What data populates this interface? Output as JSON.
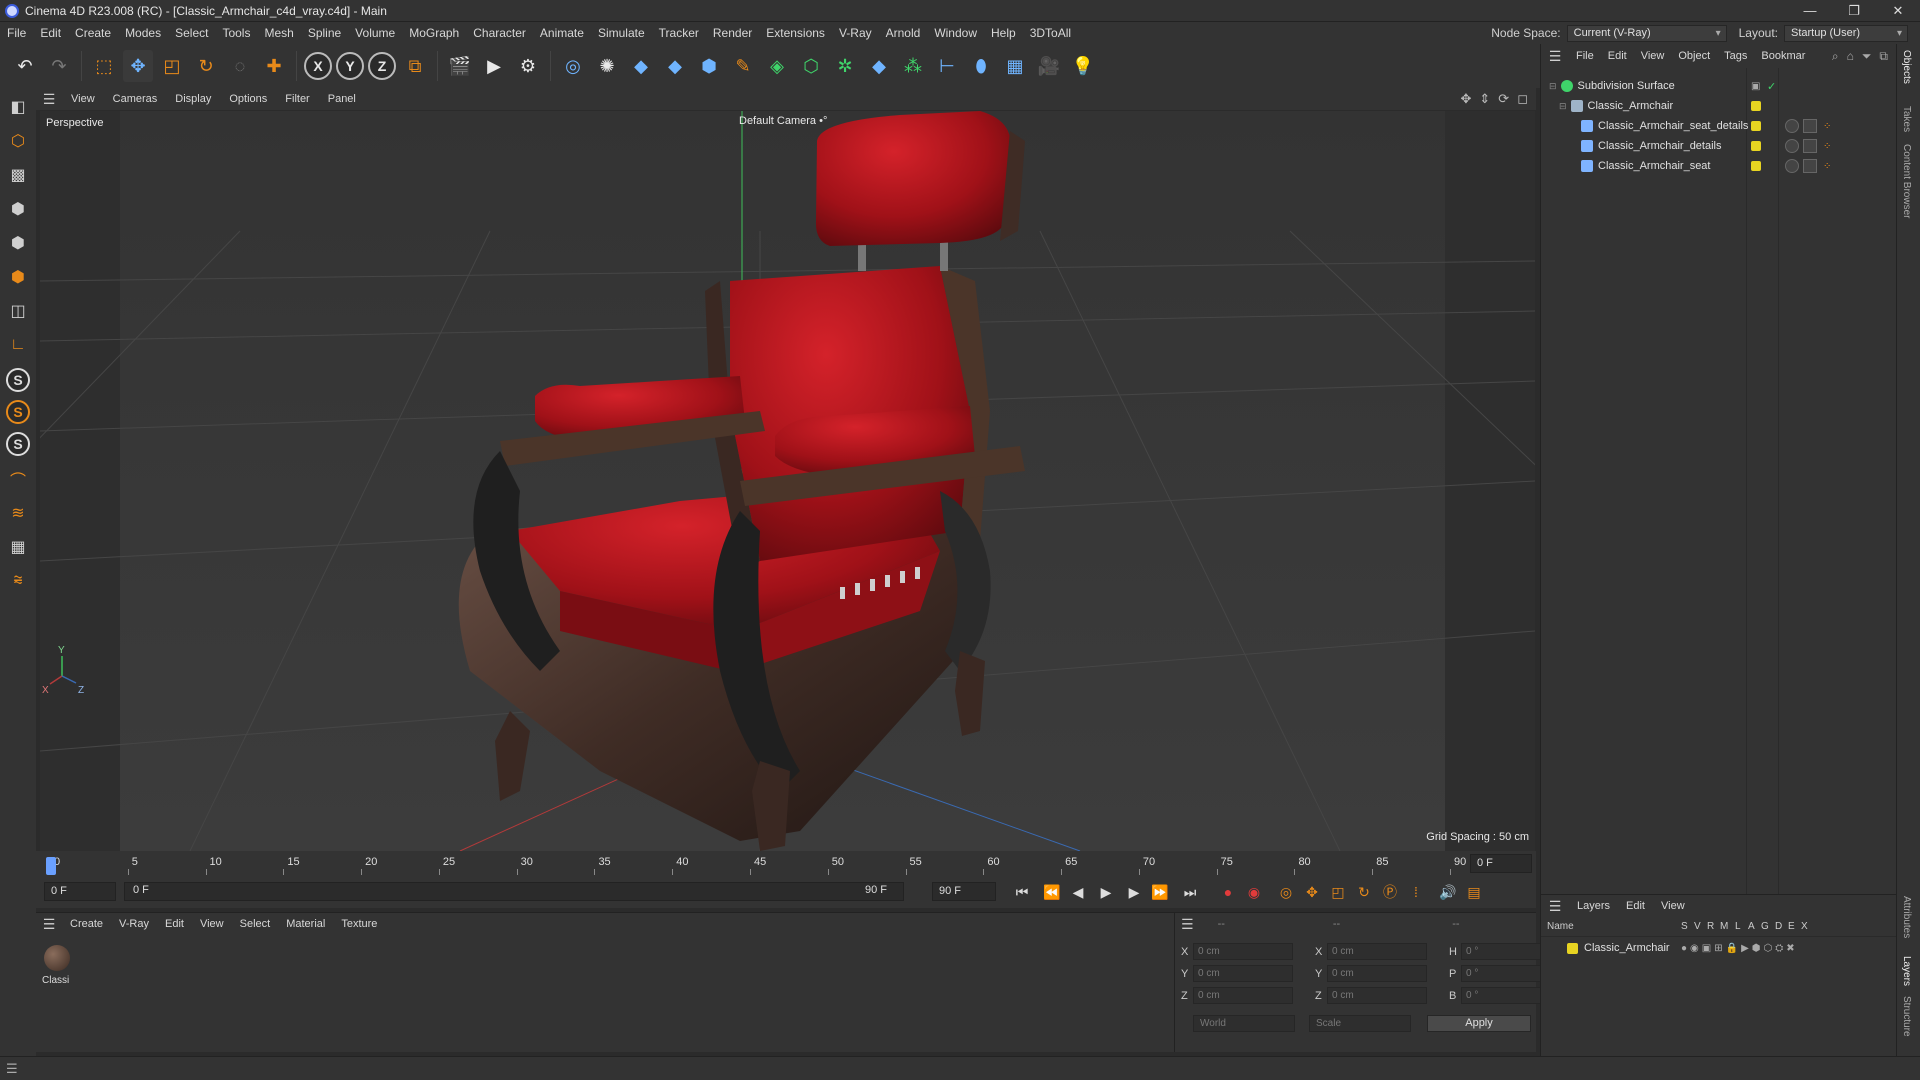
{
  "window": {
    "title": "Cinema 4D R23.008 (RC) - [Classic_Armchair_c4d_vray.c4d] - Main",
    "controls": [
      "—",
      "❐",
      "✕"
    ]
  },
  "menubar": {
    "items": [
      "File",
      "Edit",
      "Create",
      "Modes",
      "Select",
      "Tools",
      "Mesh",
      "Spline",
      "Volume",
      "MoGraph",
      "Character",
      "Animate",
      "Simulate",
      "Tracker",
      "Render",
      "Extensions",
      "V-Ray",
      "Arnold",
      "Window",
      "Help",
      "3DToAll"
    ],
    "node_space_label": "Node Space:",
    "node_space_value": "Current (V-Ray)",
    "layout_label": "Layout:",
    "layout_value": "Startup (User)"
  },
  "toolbar": {
    "axis_x": "X",
    "axis_y": "Y",
    "axis_z": "Z"
  },
  "left_toolbar": {
    "snap_s": "S"
  },
  "viewport": {
    "menu": [
      "View",
      "Cameras",
      "Display",
      "Options",
      "Filter",
      "Panel"
    ],
    "label": "Perspective",
    "camera": "Default Camera",
    "camera_suffix": "•°",
    "grid_spacing": "Grid Spacing : 50 cm",
    "axis_labels": {
      "x": "X",
      "y": "Y",
      "z": "Z"
    }
  },
  "timeline": {
    "ticks": [
      "0",
      "5",
      "10",
      "15",
      "20",
      "25",
      "30",
      "35",
      "40",
      "45",
      "50",
      "55",
      "60",
      "65",
      "70",
      "75",
      "80",
      "85",
      "90"
    ],
    "current": "0 F"
  },
  "transport": {
    "start": "0 F",
    "range_start": "0 F",
    "range_end": "90 F",
    "end": "90 F"
  },
  "material_manager": {
    "menu": [
      "Create",
      "V-Ray",
      "Edit",
      "View",
      "Select",
      "Material",
      "Texture"
    ],
    "materials": [
      {
        "name": "Classi"
      }
    ]
  },
  "coordinates": {
    "header_1": "--",
    "header_2": "--",
    "header_3": "--",
    "rows": [
      {
        "a1": "X",
        "v1": "0 cm",
        "a2": "X",
        "v2": "0 cm",
        "a3": "H",
        "v3": "0 °"
      },
      {
        "a1": "Y",
        "v1": "0 cm",
        "a2": "Y",
        "v2": "0 cm",
        "a3": "P",
        "v3": "0 °"
      },
      {
        "a1": "Z",
        "v1": "0 cm",
        "a2": "Z",
        "v2": "0 cm",
        "a3": "B",
        "v3": "0 °"
      }
    ],
    "space": "World",
    "mode": "Scale",
    "apply": "Apply"
  },
  "object_manager": {
    "menu": [
      "File",
      "Edit",
      "View",
      "Object",
      "Tags",
      "Bookmar"
    ],
    "objects": [
      {
        "name": "Subdivision Surface"
      },
      {
        "name": "Classic_Armchair"
      },
      {
        "name": "Classic_Armchair_seat_details"
      },
      {
        "name": "Classic_Armchair_details"
      },
      {
        "name": "Classic_Armchair_seat"
      }
    ]
  },
  "layer_manager": {
    "menu": [
      "Layers",
      "Edit",
      "View"
    ],
    "columns": [
      "Name",
      "S",
      "V",
      "R",
      "M",
      "L",
      "A",
      "G",
      "D",
      "E",
      "X"
    ],
    "layers": [
      {
        "name": "Classic_Armchair",
        "color": "#e8d422"
      }
    ]
  },
  "right_tabs": [
    "Objects",
    "Takes",
    "Content Browser",
    "Attributes",
    "Layers",
    "Structure"
  ],
  "colors": {
    "accent": "#e88a1a",
    "selected_blue": "#6aa0ff",
    "layer_yellow": "#e8d422",
    "chair_red": "#b3141a"
  }
}
